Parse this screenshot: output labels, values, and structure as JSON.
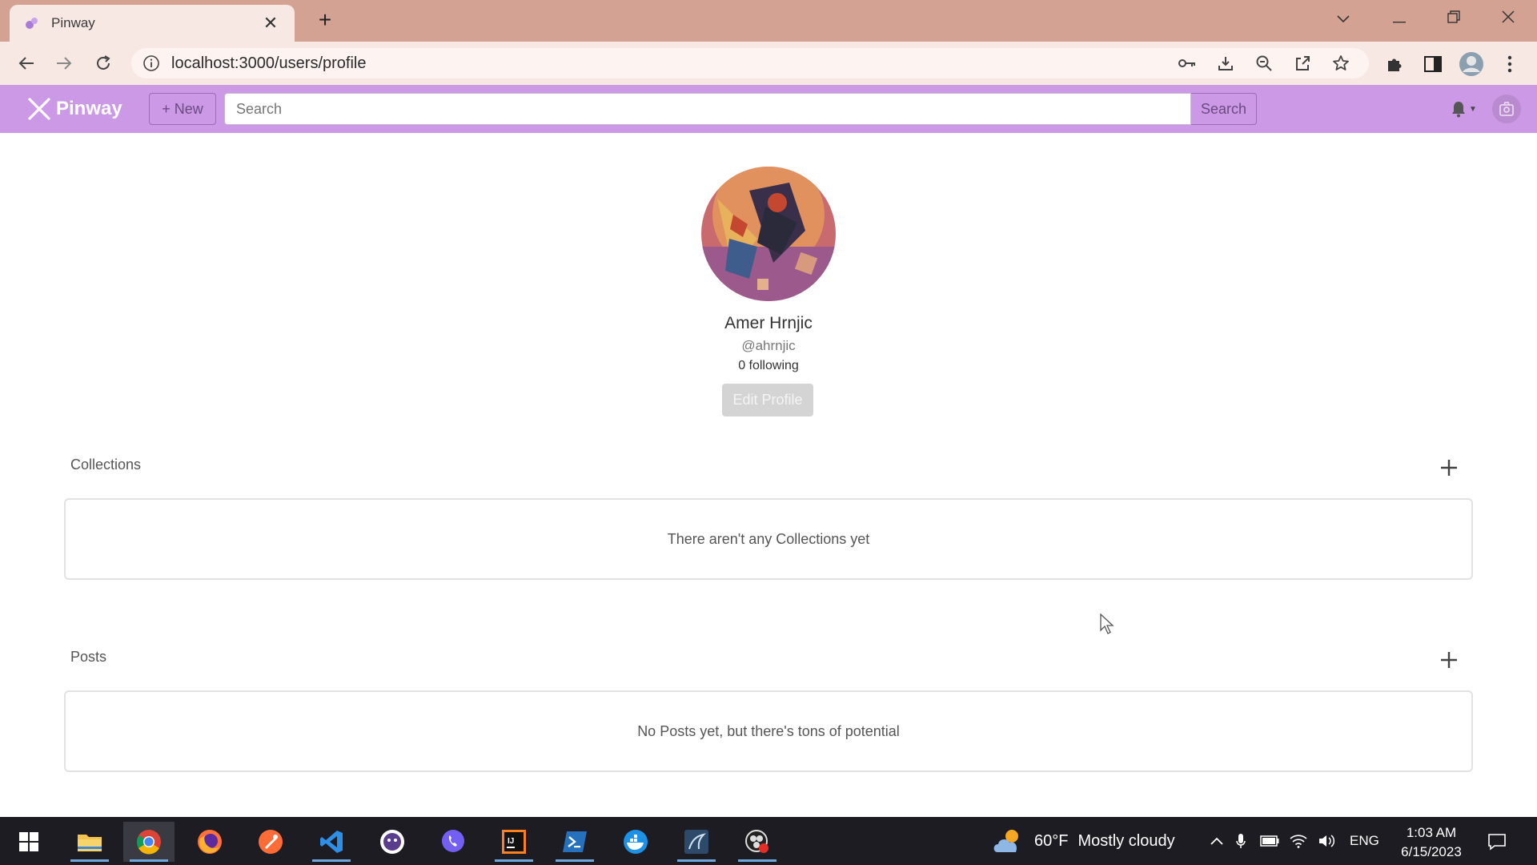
{
  "browser": {
    "tab_title": "Pinway",
    "url": "localhost:3000/users/profile"
  },
  "app": {
    "brand": "Pinway",
    "new_label": "+ New",
    "search_placeholder": "Search",
    "search_button": "Search"
  },
  "profile": {
    "name": "Amer Hrnjic",
    "handle": "@ahrnjic",
    "following": "0 following",
    "edit_label": "Edit Profile"
  },
  "collections": {
    "title": "Collections",
    "empty_text": "There aren't any Collections yet"
  },
  "posts": {
    "title": "Posts",
    "empty_text": "No Posts yet, but there's tons of potential"
  },
  "taskbar": {
    "weather_temp": "60°F",
    "weather_desc": "Mostly cloudy",
    "language": "ENG",
    "time": "1:03 AM",
    "date": "6/15/2023"
  },
  "colors": {
    "app_nav": "#cc99e6",
    "browser_frame": "#d3a293",
    "taskbar": "#1c1c22"
  }
}
